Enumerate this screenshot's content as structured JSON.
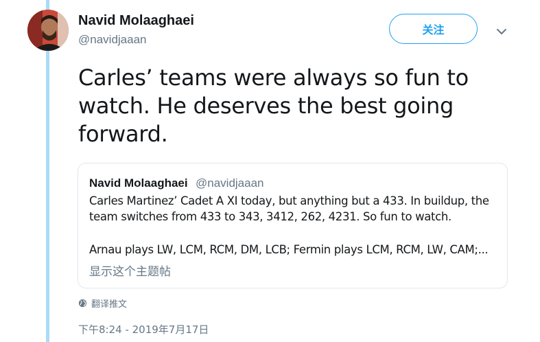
{
  "author": {
    "name": "Navid Molaaghaei",
    "handle": "@navidjaaan"
  },
  "follow_button_label": "关注",
  "menu_icon": "chevron-down-icon",
  "tweet": {
    "text": "Carles’ teams were always so fun to watch. He deserves the best going forward."
  },
  "quoted_tweet": {
    "name": "Navid Molaaghaei",
    "handle": "@navidjaaan",
    "line1": "Carles Martinez’ Cadet A XI today, but anything but a 433. In buildup, the",
    "line2": "team switches from 433 to 343, 3412, 262, 4231. So fun to watch.",
    "line3": "Arnau plays LW, LCM, RCM, DM, LCB; Fermin plays LCM, RCM, LW, CAM;...",
    "show_thread": "显示这个主题帖"
  },
  "translate": {
    "icon": "globe-icon",
    "label": "翻译推文"
  },
  "timestamp": "下午8:24 - 2019年7月17日",
  "colors": {
    "accent": "#1da1f2",
    "thread_line": "#a9dcf7",
    "muted": "#657786"
  }
}
